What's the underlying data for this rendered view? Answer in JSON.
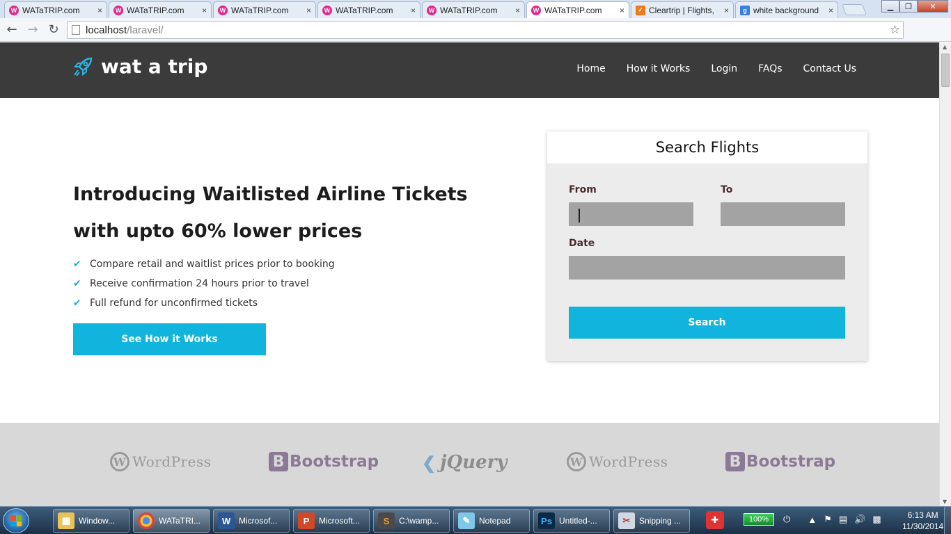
{
  "browser": {
    "tabs": [
      {
        "title": "WATaTRIP.com",
        "favicon": "watatrip-favicon",
        "active": false
      },
      {
        "title": "WATaTRIP.com",
        "favicon": "watatrip-favicon",
        "active": false
      },
      {
        "title": "WATaTRIP.com",
        "favicon": "watatrip-favicon",
        "active": false
      },
      {
        "title": "WATaTRIP.com",
        "favicon": "watatrip-favicon",
        "active": false
      },
      {
        "title": "WATaTRIP.com",
        "favicon": "watatrip-favicon",
        "active": false
      },
      {
        "title": "WATaTRIP.com",
        "favicon": "watatrip-favicon",
        "active": true
      },
      {
        "title": "Cleartrip | Flights,",
        "favicon": "cleartrip-favicon",
        "active": false
      },
      {
        "title": "white background",
        "favicon": "google-favicon",
        "active": false
      }
    ],
    "tab_close": "×",
    "url_host": "localhost",
    "url_path": "/laravel/",
    "window_controls": {
      "minimize": "▁",
      "maximize": "❐",
      "close": "✕"
    }
  },
  "site": {
    "logo_text": "wat a trip",
    "nav": [
      "Home",
      "How it Works",
      "Login",
      "FAQs",
      "Contact Us"
    ],
    "hero_line1": "Introducing Waitlisted Airline Tickets",
    "hero_line2": "with upto 60% lower prices",
    "features": [
      "Compare retail and waitlist prices prior to booking",
      "Receive confirmation 24 hours prior to travel",
      "Full refund for unconfirmed tickets"
    ],
    "cta_label": "See How it Works",
    "search": {
      "title": "Search Flights",
      "from_label": "From",
      "from_value": "",
      "to_label": "To",
      "to_value": "",
      "date_label": "Date",
      "date_value": "",
      "button_label": "Search"
    },
    "brands": [
      {
        "name": "WordPress",
        "text": "WordPress"
      },
      {
        "name": "Bootstrap",
        "text": "Bootstrap"
      },
      {
        "name": "jQuery",
        "text": "jQuery"
      },
      {
        "name": "WordPress",
        "text": "WordPress"
      },
      {
        "name": "Bootstrap",
        "text": "Bootstrap"
      }
    ]
  },
  "taskbar": {
    "items": [
      {
        "label": "Window...",
        "icon": "folder-icon"
      },
      {
        "label": "WATaTRI...",
        "icon": "chrome-icon",
        "active": true
      },
      {
        "label": "Microsof...",
        "icon": "word-icon"
      },
      {
        "label": "Microsoft...",
        "icon": "powerpoint-icon"
      },
      {
        "label": "C:\\wamp...",
        "icon": "sublime-icon"
      },
      {
        "label": "Notepad",
        "icon": "notepad-icon"
      },
      {
        "label": "Untitled-...",
        "icon": "photoshop-icon"
      },
      {
        "label": "Snipping ...",
        "icon": "snipping-icon"
      }
    ],
    "battery": "100%",
    "time": "6:13 AM",
    "date": "11/30/2014"
  },
  "colors": {
    "accent": "#11b4dc",
    "nav_bg": "#3b3b3b",
    "input_bg": "#a3a3a3"
  }
}
